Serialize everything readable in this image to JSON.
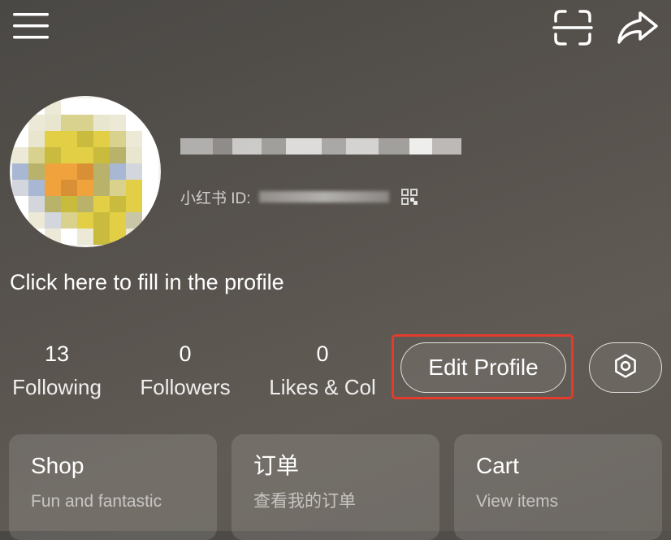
{
  "profile": {
    "id_label": "小红书 ID:",
    "bio_prompt": "Click here to fill in the profile"
  },
  "stats": [
    {
      "value": "13",
      "label": "Following"
    },
    {
      "value": "0",
      "label": "Followers"
    },
    {
      "value": "0",
      "label": "Likes & Col"
    }
  ],
  "actions": {
    "edit_profile": "Edit Profile"
  },
  "cards": [
    {
      "title": "Shop",
      "subtitle": "Fun and fantastic"
    },
    {
      "title": "订单",
      "subtitle": "查看我的订单"
    },
    {
      "title": "Cart",
      "subtitle": "View items"
    }
  ],
  "icons": {
    "menu": "menu-icon",
    "scan": "scan-icon",
    "share": "share-icon",
    "qr": "qr-code-icon",
    "settings": "gear-icon"
  },
  "colors": {
    "highlight": "#e53b2d"
  }
}
